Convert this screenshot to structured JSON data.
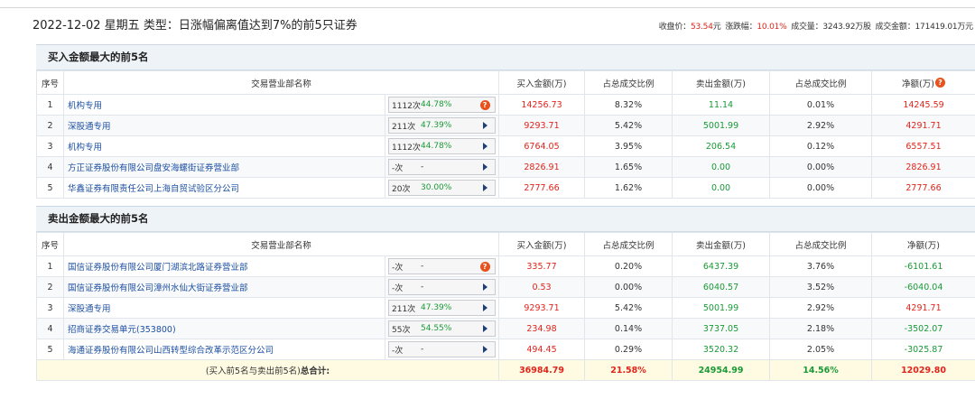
{
  "header": {
    "title": "2022-12-02 星期五 类型：日涨幅偏离值达到7%的前5只证券",
    "close_label": "收盘价：",
    "close_value": "53.54",
    "close_unit": "元",
    "change_label": "涨跌幅：",
    "change_value": "10.01%",
    "volume_label": "成交量：",
    "volume_value": "3243.92万股",
    "amount_label": "成交金额：",
    "amount_value": "171419.01万元"
  },
  "colors": {
    "up": "#e0241b",
    "down": "#1a9a36",
    "link": "#1e50a2",
    "header_bg": "#eef3f8",
    "total_bg": "#fffbe2"
  },
  "buy": {
    "section_title": "买入金额最大的前5名",
    "columns": [
      "序号",
      "交易营业部名称",
      "买入金额(万)",
      "占总成交比例",
      "卖出金额(万)",
      "占总成交比例",
      "净额(万)"
    ],
    "net_icon": "question-icon",
    "rows": [
      {
        "idx": "1",
        "name": "机构专用",
        "count": "1112次",
        "rate": "44.78%",
        "icon": "question-icon",
        "buy": "14256.73",
        "buy_pct": "8.32%",
        "sell": "11.14",
        "sell_pct": "0.01%",
        "net": "14245.59",
        "net_color": "red"
      },
      {
        "idx": "2",
        "name": "深股通专用",
        "count": "211次",
        "rate": "47.39%",
        "icon": "arrow-right-icon",
        "buy": "9293.71",
        "buy_pct": "5.42%",
        "sell": "5001.99",
        "sell_pct": "2.92%",
        "net": "4291.71",
        "net_color": "red"
      },
      {
        "idx": "3",
        "name": "机构专用",
        "count": "1112次",
        "rate": "44.78%",
        "icon": "arrow-right-icon",
        "buy": "6764.05",
        "buy_pct": "3.95%",
        "sell": "206.54",
        "sell_pct": "0.12%",
        "net": "6557.51",
        "net_color": "red"
      },
      {
        "idx": "4",
        "name": "方正证券股份有限公司盘安海螺街证券营业部",
        "count": "-次",
        "rate": "-",
        "icon": "arrow-right-icon",
        "buy": "2826.91",
        "buy_pct": "1.65%",
        "sell": "0.00",
        "sell_pct": "0.00%",
        "net": "2826.91",
        "net_color": "red"
      },
      {
        "idx": "5",
        "name": "华鑫证券有限责任公司上海自贸试验区分公司",
        "count": "20次",
        "rate": "30.00%",
        "icon": "arrow-right-icon",
        "buy": "2777.66",
        "buy_pct": "1.62%",
        "sell": "0.00",
        "sell_pct": "0.00%",
        "net": "2777.66",
        "net_color": "red"
      }
    ]
  },
  "sell": {
    "section_title": "卖出金额最大的前5名",
    "columns": [
      "序号",
      "交易营业部名称",
      "买入金额(万)",
      "占总成交比例",
      "卖出金额(万)",
      "占总成交比例",
      "净额(万)"
    ],
    "rows": [
      {
        "idx": "1",
        "name": "国信证券股份有限公司厦门湖滨北路证券营业部",
        "count": "-次",
        "rate": "-",
        "icon": "question-icon",
        "buy": "335.77",
        "buy_pct": "0.20%",
        "sell": "6437.39",
        "sell_pct": "3.76%",
        "net": "-6101.61",
        "net_color": "green"
      },
      {
        "idx": "2",
        "name": "国信证券股份有限公司漳州水仙大街证券营业部",
        "count": "-次",
        "rate": "-",
        "icon": "arrow-right-icon",
        "buy": "0.53",
        "buy_pct": "0.00%",
        "sell": "6040.57",
        "sell_pct": "3.52%",
        "net": "-6040.04",
        "net_color": "green"
      },
      {
        "idx": "3",
        "name": "深股通专用",
        "count": "211次",
        "rate": "47.39%",
        "icon": "arrow-right-icon",
        "buy": "9293.71",
        "buy_pct": "5.42%",
        "sell": "5001.99",
        "sell_pct": "2.92%",
        "net": "4291.71",
        "net_color": "red"
      },
      {
        "idx": "4",
        "name": "招商证券交易单元(353800)",
        "count": "55次",
        "rate": "54.55%",
        "icon": "arrow-right-icon",
        "buy": "234.98",
        "buy_pct": "0.14%",
        "sell": "3737.05",
        "sell_pct": "2.18%",
        "net": "-3502.07",
        "net_color": "green"
      },
      {
        "idx": "5",
        "name": "海通证券股份有限公司山西转型综合改革示范区分公司",
        "count": "-次",
        "rate": "-",
        "icon": "arrow-right-icon",
        "buy": "494.45",
        "buy_pct": "0.29%",
        "sell": "3520.32",
        "sell_pct": "2.05%",
        "net": "-3025.87",
        "net_color": "green"
      }
    ],
    "total": {
      "label_prefix": "(买入前5名与卖出前5名)",
      "label_bold": "总合计:",
      "buy": "36984.79",
      "buy_pct": "21.58%",
      "sell": "24954.99",
      "sell_pct": "14.56%",
      "net": "12029.80"
    }
  }
}
